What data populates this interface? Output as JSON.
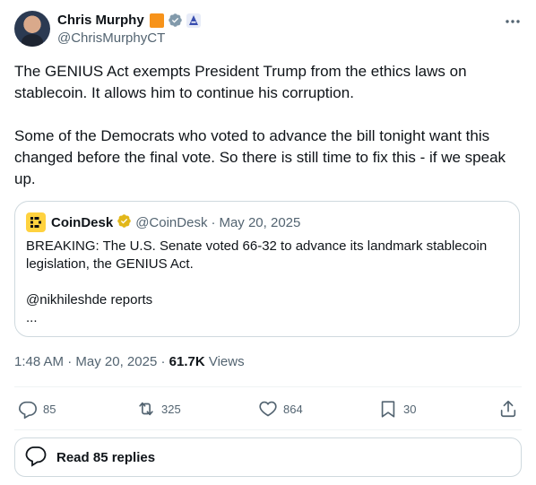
{
  "author": {
    "name": "Chris Murphy",
    "handle": "@ChrisMurphyCT"
  },
  "tweet": {
    "text": "The GENIUS Act exempts President Trump from the ethics laws on stablecoin. It allows him to continue his corruption.\n\nSome of the Democrats who voted to advance the bill tonight want this changed before the final vote. So there is still time to fix this - if we speak up."
  },
  "quote": {
    "name": "CoinDesk",
    "handle": "@CoinDesk",
    "separator": "·",
    "date": "May 20, 2025",
    "text": "BREAKING: The U.S. Senate voted 66-32 to advance its landmark stablecoin legislation, the GENIUS Act.\n\n@nikhileshde reports\n..."
  },
  "meta": {
    "time": "1:48 AM",
    "sep1": "·",
    "date": "May 20, 2025",
    "sep2": "·",
    "views_count": "61.7K",
    "views_label": "Views"
  },
  "actions": {
    "replies": "85",
    "reposts": "325",
    "likes": "864",
    "bookmarks": "30"
  },
  "read_replies": "Read 85 replies",
  "colors": {
    "text": "#0f1419",
    "secondary": "#536471",
    "verified_blue": "#829aab",
    "gold_badge": "#e2b719",
    "coindesk_yellow": "#ffd23f",
    "orange_badge": "#f7931a"
  },
  "icons": [
    "more-icon",
    "verified-icon",
    "affiliate-icon",
    "reply-icon",
    "repost-icon",
    "like-icon",
    "bookmark-icon",
    "share-icon",
    "conversation-icon"
  ]
}
